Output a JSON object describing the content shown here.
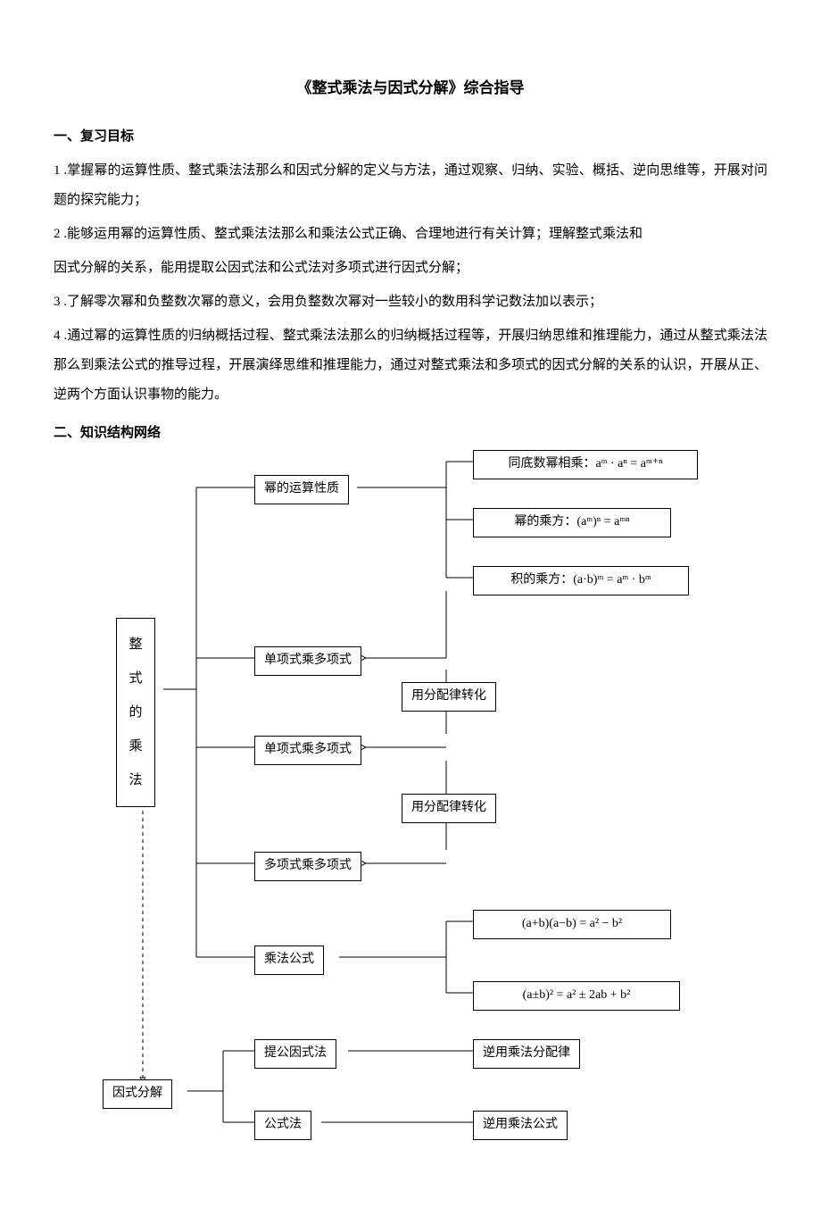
{
  "title": "《整式乘法与因式分解》综合指导",
  "sections": {
    "s1_heading": "一、复习目标",
    "s1_items": [
      "1 .掌握幂的运算性质、整式乘法法那么和因式分解的定义与方法，通过观察、归纳、实验、概括、逆向思维等，开展对问题的探究能力；",
      "2 .能够运用幂的运算性质、整式乘法法那么和乘法公式正确、合理地进行有关计算；理解整式乘法和",
      "因式分解的关系，能用提取公因式法和公式法对多项式进行因式分解；",
      "3 .了解零次幂和负整数次幂的意义，会用负整数次幂对一些较小的数用科学记数法加以表示；",
      "4 .通过幂的运算性质的归纳概括过程、整式乘法法那么的归纳概括过程等，开展归纳思维和推理能力，通过从整式乘法法那么到乘法公式的推导过程，开展演绎思维和推理能力，通过对整式乘法和多项式的因式分解的关系的认识，开展从正、逆两个方面认识事物的能力。"
    ],
    "s2_heading": "二、知识结构网络"
  },
  "diagram": {
    "main_mul": "整\n式\n的\n乘\n法",
    "main_fac": "因式分解",
    "power_prop": "幂的运算性质",
    "mono_poly_1": "单项式乘多项式",
    "mono_poly_2": "单项式乘多项式",
    "poly_poly": "多项式乘多项式",
    "mul_formula": "乘法公式",
    "common_factor": "提公因式法",
    "formula_method": "公式法",
    "same_base": "同底数幂相乘：aᵐ · aⁿ = aᵐ⁺ⁿ",
    "power_power": "幂的乘方：(aᵐ)ⁿ = aᵐⁿ",
    "product_power": "积的乘方：(a·b)ᵐ = aᵐ · bᵐ",
    "dist_convert_1": "用分配律转化",
    "dist_convert_2": "用分配律转化",
    "sq_diff": "(a+b)(a−b) = a² − b²",
    "perfect_sq": "(a±b)² = a² ± 2ab + b²",
    "inverse_dist": "逆用乘法分配律",
    "inverse_formula": "逆用乘法公式"
  }
}
